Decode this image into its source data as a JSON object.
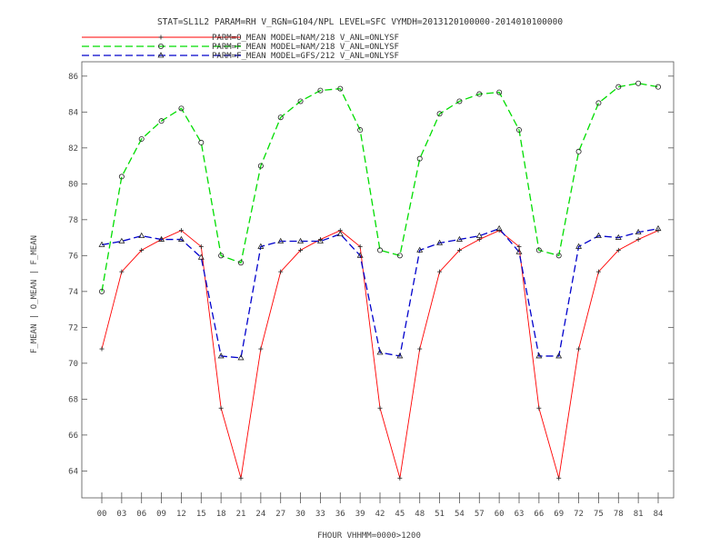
{
  "title": "STAT=SL1L2 PARAM=RH V_RGN=G104/NPL LEVEL=SFC VYMDH=2013120100000-2014010100000",
  "colors": {
    "o_mean": "#ff0000",
    "nam": "#00dd00",
    "gfs": "#0000cc",
    "axis": "#555555"
  },
  "chart_data": {
    "type": "line",
    "title": "STAT=SL1L2 PARAM=RH V_RGN=G104/NPL LEVEL=SFC VYMDH=2013120100000-2014010100000",
    "xlabel": "FHOUR VHHMM=0000>1200",
    "ylabel": "F_MEAN | O_MEAN | F_MEAN",
    "ylim": [
      62.5,
      86.8
    ],
    "yticks": [
      64,
      66,
      68,
      70,
      72,
      74,
      76,
      78,
      80,
      82,
      84,
      86
    ],
    "x": [
      "00",
      "03",
      "06",
      "09",
      "12",
      "15",
      "18",
      "21",
      "24",
      "27",
      "30",
      "33",
      "36",
      "39",
      "42",
      "45",
      "48",
      "51",
      "54",
      "57",
      "60",
      "63",
      "66",
      "69",
      "72",
      "75",
      "78",
      "81",
      "84"
    ],
    "grid": false,
    "legend_position": "top-left",
    "series": [
      {
        "name": "PARM=O_MEAN MODEL=NAM/218 V_ANL=ONLYSF",
        "color": "#ff0000",
        "dash": "solid",
        "marker": "plus",
        "values": [
          70.8,
          75.1,
          76.3,
          76.9,
          77.4,
          76.5,
          67.5,
          63.6,
          70.8,
          75.1,
          76.3,
          76.9,
          77.4,
          76.5,
          67.5,
          63.6,
          70.8,
          75.1,
          76.3,
          76.9,
          77.4,
          76.5,
          67.5,
          63.6,
          70.8,
          75.1,
          76.3,
          76.9,
          77.4
        ]
      },
      {
        "name": "PARM=F_MEAN MODEL=NAM/218 V_ANL=ONLYSF",
        "color": "#00dd00",
        "dash": "long",
        "marker": "circle",
        "values": [
          74.0,
          80.4,
          82.5,
          83.5,
          84.2,
          82.3,
          76.0,
          75.6,
          81.0,
          83.7,
          84.6,
          85.2,
          85.3,
          83.0,
          76.3,
          76.0,
          81.4,
          83.9,
          84.6,
          85.0,
          85.1,
          83.0,
          76.3,
          76.0,
          81.8,
          84.5,
          85.4,
          85.6,
          85.4
        ]
      },
      {
        "name": "PARM=F_MEAN MODEL=GFS/212 V_ANL=ONLYSF",
        "color": "#0000cc",
        "dash": "long",
        "marker": "triangle",
        "values": [
          76.6,
          76.8,
          77.1,
          76.9,
          76.9,
          75.9,
          70.4,
          70.3,
          76.5,
          76.8,
          76.8,
          76.8,
          77.2,
          76.0,
          70.6,
          70.4,
          76.3,
          76.7,
          76.9,
          77.1,
          77.5,
          76.2,
          70.4,
          70.4,
          76.5,
          77.1,
          77.0,
          77.3,
          77.5
        ]
      }
    ]
  }
}
